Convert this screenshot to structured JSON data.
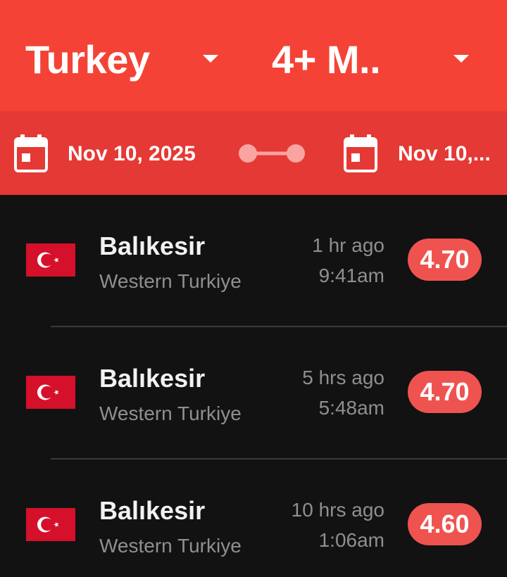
{
  "header": {
    "country_label": "Turkey",
    "magnitude_label": "4+ M.."
  },
  "date_range": {
    "start": "Nov 10, 2025",
    "end": "Nov 10,..."
  },
  "colors": {
    "header": "#f44336",
    "datebar": "#e53935",
    "badge": "#ef5350",
    "background": "#121212"
  },
  "icons": {
    "calendar": "calendar-icon",
    "range": "range-connector-icon",
    "flag": "turkey-flag-icon",
    "dropdown": "chevron-down-icon"
  },
  "quakes": [
    {
      "place": "Balıkesir",
      "region": "Western Turkiye",
      "ago": "1 hr ago",
      "time": "9:41am",
      "magnitude": "4.70"
    },
    {
      "place": "Balıkesir",
      "region": "Western Turkiye",
      "ago": "5 hrs ago",
      "time": "5:48am",
      "magnitude": "4.70"
    },
    {
      "place": "Balıkesir",
      "region": "Western Turkiye",
      "ago": "10 hrs ago",
      "time": "1:06am",
      "magnitude": "4.60"
    }
  ]
}
